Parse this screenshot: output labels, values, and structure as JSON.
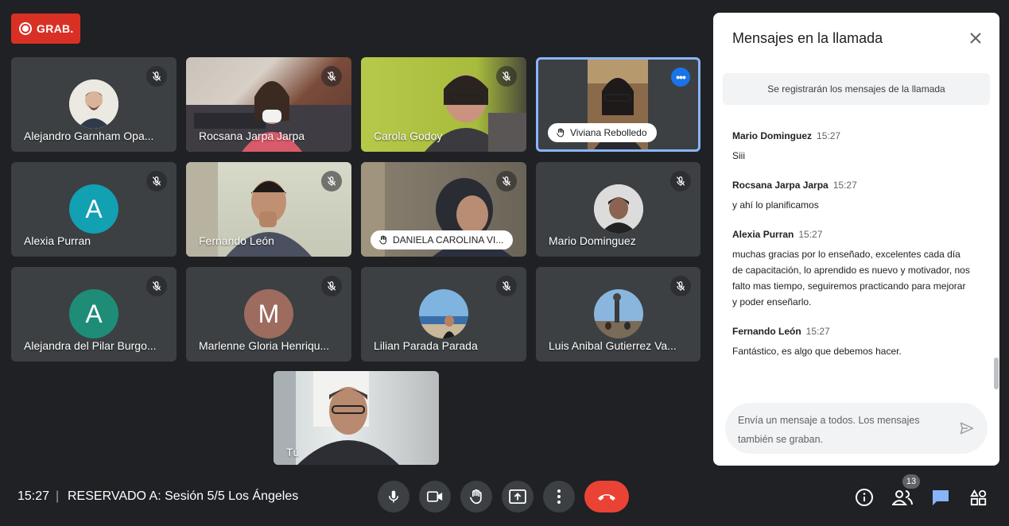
{
  "recording": {
    "label": "GRAB."
  },
  "tiles": [
    {
      "name": "Alejandro Garnham Opa...",
      "kind": "photo-avatar"
    },
    {
      "name": "Rocsana Jarpa Jarpa",
      "kind": "video"
    },
    {
      "name": "Carola Godoy",
      "kind": "video"
    },
    {
      "name": "Viviana Rebolledo",
      "kind": "video",
      "hand_raised": true,
      "active": true
    },
    {
      "name": "Alexia Purran",
      "kind": "letter",
      "letter": "A",
      "color": "#12a0b3"
    },
    {
      "name": "Fernando León",
      "kind": "video"
    },
    {
      "name": "DANIELA CAROLINA VI...",
      "kind": "video",
      "hand_raised": true
    },
    {
      "name": "Mario Dominguez",
      "kind": "photo-avatar"
    },
    {
      "name": "Alejandra del Pilar Burgo...",
      "kind": "letter",
      "letter": "A",
      "color": "#1e8c77"
    },
    {
      "name": "Marlenne Gloria Henriqu...",
      "kind": "letter",
      "letter": "M",
      "color": "#9e6b5f"
    },
    {
      "name": "Lilian Parada Parada",
      "kind": "photo-avatar"
    },
    {
      "name": "Luis Anibal Gutierrez Va...",
      "kind": "photo-avatar"
    },
    {
      "name": "Tú",
      "kind": "video"
    }
  ],
  "chat": {
    "title": "Mensajes en la llamada",
    "notice": "Se registrarán los mensajes de la llamada",
    "messages": [
      {
        "author": "Mario Dominguez",
        "time": "15:27",
        "text": "Siii"
      },
      {
        "author": "Rocsana Jarpa Jarpa",
        "time": "15:27",
        "text": "y  ahí lo planificamos"
      },
      {
        "author": "Alexia Purran",
        "time": "15:27",
        "text": "muchas gracias por lo enseñado, excelentes cada día de capacitación, lo aprendido es nuevo y motivador, nos falto mas tiempo, seguiremos practicando para mejorar y poder enseñarlo."
      },
      {
        "author": "Fernando León",
        "time": "15:27",
        "text": "Fantástico, es algo que debemos hacer."
      }
    ],
    "composer_placeholder": "Envía un mensaje a todos. Los mensajes también se graban."
  },
  "bottom": {
    "time": "15:27",
    "separator": "|",
    "meeting_title": "RESERVADO A: Sesión 5/5 Los Ángeles",
    "participants_count": "13"
  },
  "icons": [
    "record-icon",
    "mic-off-icon",
    "raise-hand-icon",
    "more-icon",
    "close-icon",
    "send-icon",
    "mic-icon",
    "camera-icon",
    "present-icon",
    "more-vert-icon",
    "hangup-icon",
    "info-icon",
    "people-icon",
    "chat-icon",
    "activities-icon"
  ]
}
